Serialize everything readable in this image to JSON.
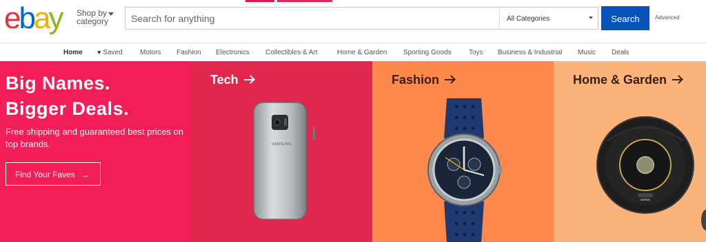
{
  "logo": {
    "letters": [
      "e",
      "b",
      "a",
      "y"
    ],
    "colors": [
      "#e53238",
      "#0064d2",
      "#f5af02",
      "#86b817"
    ]
  },
  "shop_by": {
    "line1": "Shop by",
    "line2": "category"
  },
  "search": {
    "placeholder": "Search for anything",
    "category": "All Categories",
    "button": "Search",
    "advanced": "Advanced"
  },
  "nav": {
    "items": [
      "Home",
      "Saved",
      "Motors",
      "Fashion",
      "Electronics",
      "Collectibles & Art",
      "Home & Garden",
      "Sporting Goods",
      "Toys",
      "Business & Industrial",
      "Music",
      "Deals"
    ]
  },
  "hero": {
    "headline1": "Big Names.",
    "headline2": "Bigger Deals.",
    "subtext": "Free shipping and guaranteed best prices on top brands.",
    "cta": "Find Your Faves",
    "cta_arrow": "→"
  },
  "panels": [
    {
      "title": "Tech",
      "color": "#fff",
      "bg": "#e1274c"
    },
    {
      "title": "Fashion",
      "color": "#3a1d0e",
      "bg": "#fd8a4c"
    },
    {
      "title": "Home & Garden",
      "color": "#3a1d0e",
      "bg": "#fbb37a"
    }
  ],
  "phone_brand": "SAMSUNG"
}
